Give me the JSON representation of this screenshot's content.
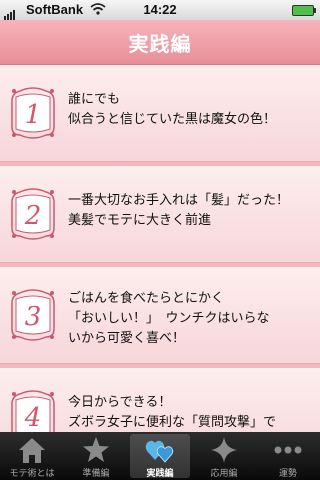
{
  "status": {
    "carrier": "SoftBank",
    "time": "14:22"
  },
  "header": {
    "title": "実践編"
  },
  "items": [
    {
      "number": "1",
      "line1": "誰にでも",
      "line2": "似合うと信じていた黒は魔女の色！",
      "line3": ""
    },
    {
      "number": "2",
      "line1": "一番大切なお手入れは「髪」だった！",
      "line2": "美髪でモテに大きく前進",
      "line3": ""
    },
    {
      "number": "3",
      "line1": "ごはんを食べたらとにかく",
      "line2": "「おいしい！」　ウンチクはいらな",
      "line3": "いから可愛く喜べ！"
    },
    {
      "number": "4",
      "line1": "今日からできる！",
      "line2": "ズボラ女子に便利な「質問攻撃」で",
      "line3": ""
    }
  ],
  "tabs": [
    {
      "label": "モテ術とは",
      "icon": "house-icon",
      "active": false
    },
    {
      "label": "準備編",
      "icon": "star-icon",
      "active": false
    },
    {
      "label": "実践編",
      "icon": "hearts-icon",
      "active": true
    },
    {
      "label": "応用編",
      "icon": "sparkle-icon",
      "active": false
    },
    {
      "label": "運勢",
      "icon": "more-icon",
      "active": false
    }
  ],
  "colors": {
    "accent": "#e88e98",
    "number_color": "#d2566c",
    "tabbar": "#111111"
  }
}
